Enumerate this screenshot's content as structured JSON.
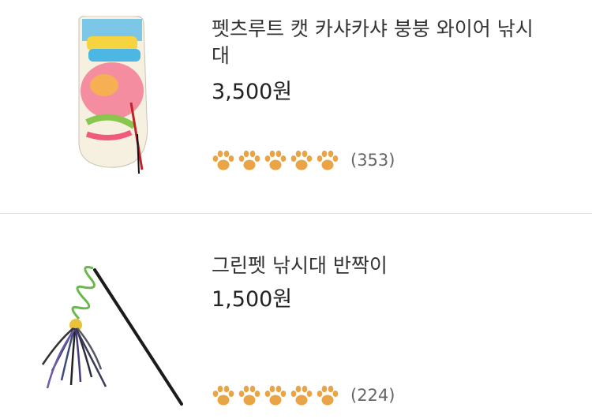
{
  "items": [
    {
      "title": "펫츠루트 캣 카샤카샤 붕붕 와이어 낚시대",
      "price": "3,500원",
      "rating_stars": 5,
      "review_count": "(353)",
      "image": "cat-toy-package-image"
    },
    {
      "title": "그린펫 낚시대 반짝이",
      "price": "1,500원",
      "rating_stars": 5,
      "review_count": "(224)",
      "image": "cat-teaser-wand-image"
    }
  ],
  "colors": {
    "paw": "#e9a545",
    "divider": "#e2e2e2"
  },
  "icons": {
    "rating": "paw-icon"
  }
}
